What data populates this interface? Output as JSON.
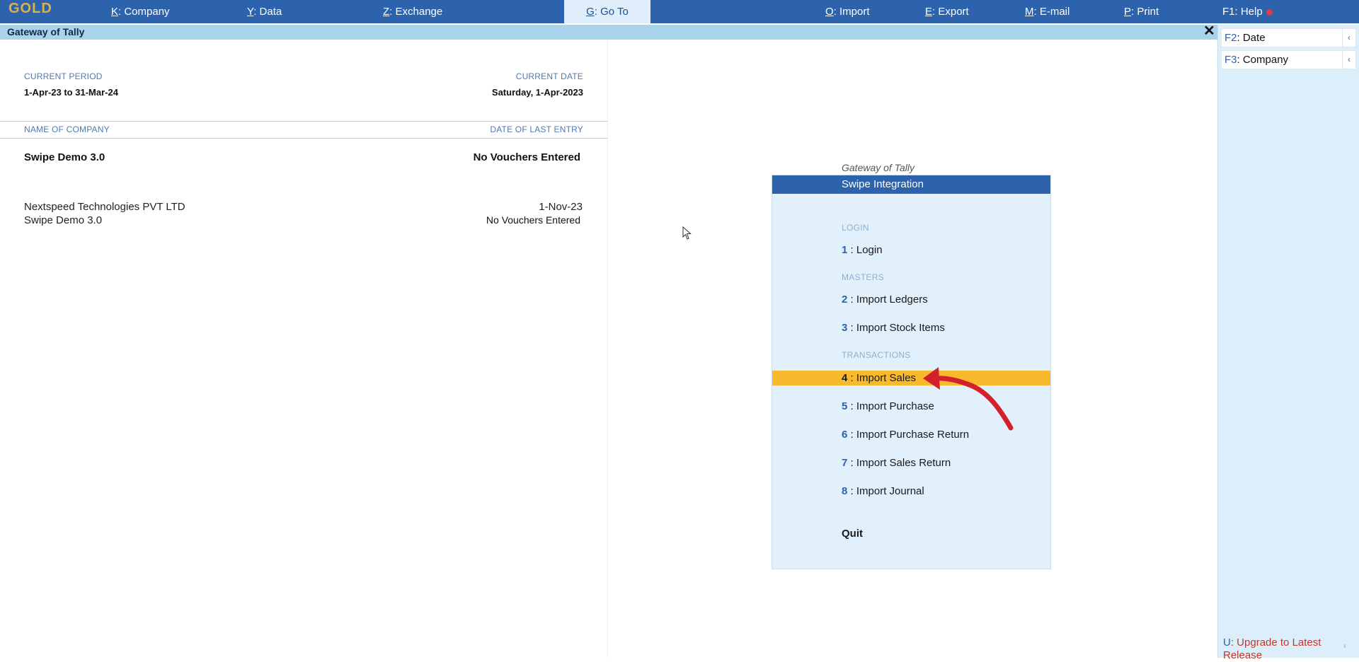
{
  "topbar": {
    "brand": "GOLD",
    "menu": [
      {
        "key": "K",
        "label": ": Company"
      },
      {
        "key": "Y",
        "label": ": Data"
      },
      {
        "key": "Z",
        "label": ": Exchange"
      },
      {
        "key": "G",
        "label": ": Go To"
      },
      {
        "key": "O",
        "label": ": Import"
      },
      {
        "key": "E",
        "label": ": Export"
      },
      {
        "key": "M",
        "label": ": E-mail"
      },
      {
        "key": "P",
        "label": ": Print"
      },
      {
        "key": "F1",
        "label": ": Help"
      }
    ]
  },
  "window": {
    "title": "Gateway of Tally",
    "close_glyph": "✕"
  },
  "left": {
    "current_period_label": "CURRENT PERIOD",
    "current_period": "1-Apr-23 to 31-Mar-24",
    "current_date_label": "CURRENT DATE",
    "current_date": "Saturday, 1-Apr-2023",
    "name_of_company_label": "NAME OF COMPANY",
    "date_of_last_entry_label": "DATE OF LAST ENTRY",
    "company_name": "Swipe Demo 3.0",
    "company_last_entry": "No Vouchers Entered",
    "group_name": "Nextspeed Technologies PVT LTD",
    "group_last_entry": "1-Nov-23",
    "sub_company_name": "Swipe Demo 3.0",
    "sub_company_last_entry": "No Vouchers Entered"
  },
  "sidebar": {
    "buttons": [
      {
        "key": "F2",
        "label": ": Date",
        "arrow": "‹"
      },
      {
        "key": "F3",
        "label": ": Company",
        "arrow": "‹"
      }
    ],
    "upgrade": {
      "key": "U",
      "label": ": Upgrade to Latest Release",
      "arrow": "‹"
    }
  },
  "panel": {
    "caption": "Gateway of Tally",
    "title": "Swipe Integration",
    "sections": {
      "login": "LOGIN",
      "masters": "MASTERS",
      "transactions": "TRANSACTIONS"
    },
    "options": [
      {
        "num": "1",
        "label": " : Login"
      },
      {
        "num": "2",
        "label": " : Import Ledgers"
      },
      {
        "num": "3",
        "label": " : Import Stock Items"
      },
      {
        "num": "4",
        "label": " : Import Sales"
      },
      {
        "num": "5",
        "label": " : Import Purchase"
      },
      {
        "num": "6",
        "label": " : Import Purchase Return"
      },
      {
        "num": "7",
        "label": " : Import Sales Return"
      },
      {
        "num": "8",
        "label": " : Import Journal"
      }
    ],
    "selected_option": "4",
    "quit": "Quit"
  },
  "colors": {
    "accent": "#2d62ad",
    "highlight": "#f8b92d",
    "title_bar": "#a9d3ec",
    "annotation_arrow": "#d3212c"
  }
}
